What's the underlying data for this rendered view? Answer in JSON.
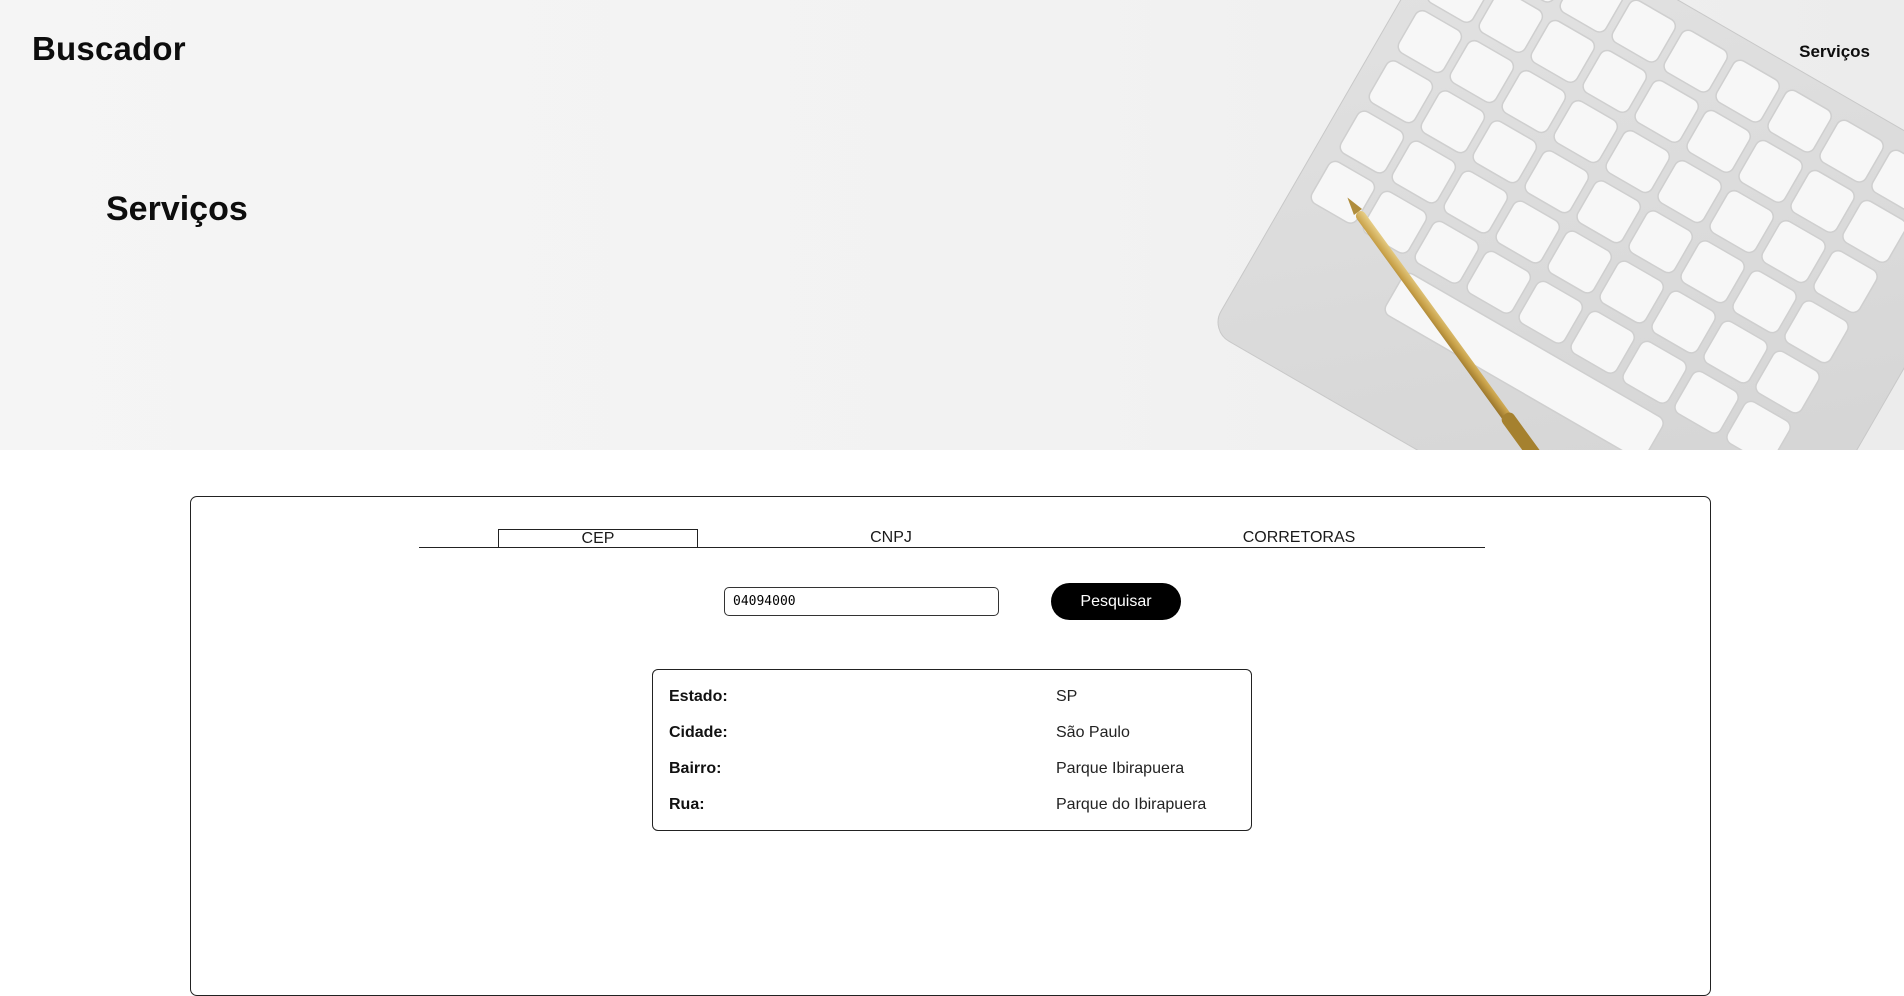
{
  "header": {
    "brand": "Buscador",
    "nav_link": "Serviços",
    "hero_title": "Serviços"
  },
  "tabs": [
    {
      "label": "CEP",
      "active": true
    },
    {
      "label": "CNPJ",
      "active": false
    },
    {
      "label": "CORRETORAS",
      "active": false
    }
  ],
  "search": {
    "value": "04094000",
    "button_label": "Pesquisar"
  },
  "result": {
    "rows": [
      {
        "label": "Estado:",
        "value": "SP"
      },
      {
        "label": "Cidade:",
        "value": "São Paulo"
      },
      {
        "label": "Bairro:",
        "value": "Parque Ibirapuera"
      },
      {
        "label": "Rua:",
        "value": "Parque do Ibirapuera"
      }
    ]
  },
  "colors": {
    "text": "#0d0d0d",
    "button_bg": "#000000",
    "button_text": "#ffffff",
    "hero_bg": "#f2f2f2",
    "pen_gold": "#c9a24a"
  },
  "icons": {
    "hero_image": "keyboard-and-pen-image"
  }
}
